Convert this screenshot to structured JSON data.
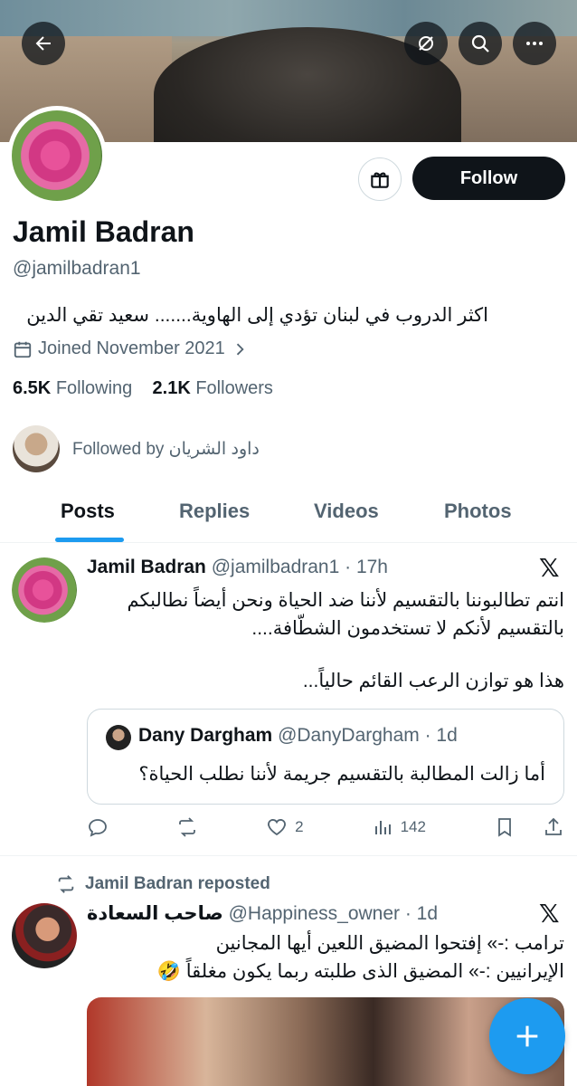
{
  "header": {
    "back_icon": "arrow-left-icon",
    "grok_icon": "grok-icon",
    "search_icon": "search-icon",
    "more_icon": "more-icon"
  },
  "profile": {
    "name": "Jamil Badran",
    "handle": "@jamilbadran1",
    "bio": "اكثر الدروب في لبنان تؤدي إلى الهاوية....... سعيد تقي الدين",
    "joined": "Joined November 2021",
    "following_count": "6.5K",
    "following_label": "Following",
    "followers_count": "2.1K",
    "followers_label": "Followers",
    "followed_by": "Followed by داود الشريان",
    "follow_label": "Follow"
  },
  "tabs": [
    {
      "label": "Posts",
      "active": true
    },
    {
      "label": "Replies",
      "active": false
    },
    {
      "label": "Videos",
      "active": false
    },
    {
      "label": "Photos",
      "active": false
    }
  ],
  "tweets": [
    {
      "author": "Jamil Badran",
      "handle_time": "@jamilbadran1 · 17h",
      "text_line1": "انتم تطالبوننا بالتقسيم لأننا ضد  الحياة ونحن أيضاً نطالبكم",
      "text_line2": "بالتقسيم لأنكم لا تستخدمون الشطّافة....",
      "text_line3": "هذا هو توازن الرعب القائم حالياً...",
      "quote": {
        "author": "Dany Dargham",
        "handle_time": "@DanyDargham · 1d",
        "text": "أما زالت المطالبة بالتقسيم جريمة لأننا نطلب الحياة؟"
      },
      "actions": {
        "reply": "",
        "repost": "",
        "likes": "2",
        "views": "142"
      }
    },
    {
      "repost_by": "Jamil Badran reposted",
      "author": "صاحب السعادة",
      "handle_time": "@Happiness_owner · 1d",
      "text_line1": "ترامب :-» إفتحوا المضيق اللعين أيها المجانين",
      "text_line2": "الإيرانيين :-» المضيق الذى طلبته ربما يكون مغلقاً 🤣"
    }
  ]
}
